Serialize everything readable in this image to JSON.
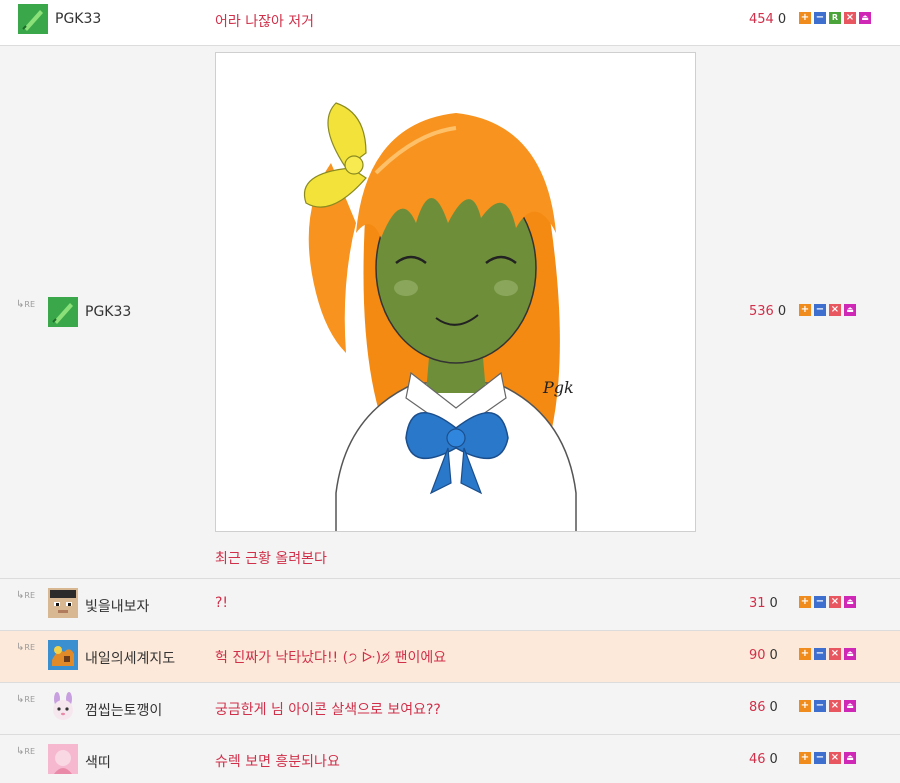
{
  "re_label": "RE",
  "posts": [
    {
      "nick": "PGK33",
      "title": "어라 나잖아 저거",
      "score": "454",
      "count": "0",
      "buttons": [
        "+",
        "−",
        "R",
        "×",
        "⏏"
      ]
    },
    {
      "nick": "PGK33",
      "title": "최근 근황 올려본다",
      "score": "536",
      "count": "0",
      "signature": "Pgk",
      "buttons": [
        "+",
        "−",
        "×",
        "⏏"
      ]
    },
    {
      "nick": "빛을내보자",
      "title": "?!",
      "score": "31",
      "count": "0",
      "buttons": [
        "+",
        "−",
        "×",
        "⏏"
      ]
    },
    {
      "nick": "내일의세계지도",
      "title": "헉 진짜가 낙타났다!! (੭ ᐕ)੭̸ 팬이에요",
      "score": "90",
      "count": "0",
      "buttons": [
        "+",
        "−",
        "×",
        "⏏"
      ]
    },
    {
      "nick": "껌씹는토깽이",
      "title": "궁금한게 님 아이콘 살색으로 보여요??",
      "score": "86",
      "count": "0",
      "buttons": [
        "+",
        "−",
        "×",
        "⏏"
      ]
    },
    {
      "nick": "색띠",
      "title": "슈렉 보면 흥분되나요",
      "score": "46",
      "count": "0",
      "buttons": [
        "+",
        "−",
        "×",
        "⏏"
      ]
    }
  ],
  "colors": {
    "title_red": "#d0304a",
    "plus": "#f08c1e",
    "minus": "#3e6fcf",
    "r": "#4aa43a",
    "x": "#e8565f",
    "alarm": "#cf28b6",
    "highlight_row": "#fde9d9"
  }
}
